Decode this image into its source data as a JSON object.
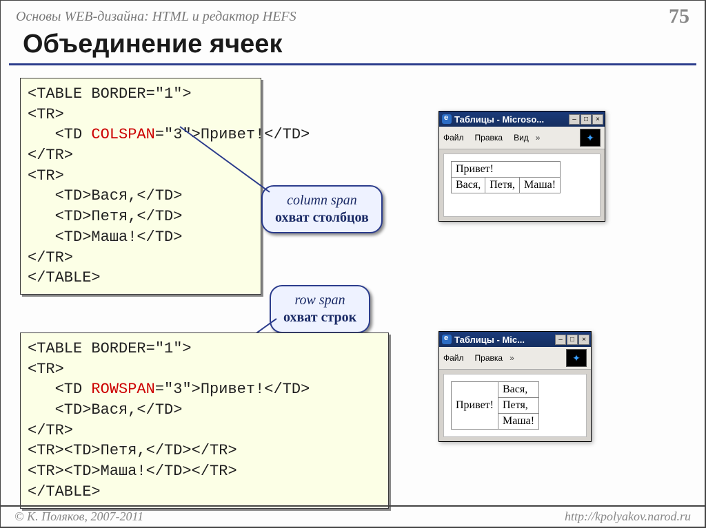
{
  "header": {
    "course": "Основы WEB-дизайна: HTML и редактор HEFS",
    "page": "75"
  },
  "title": "Объединение ячеек",
  "code1": {
    "l1": "<TABLE BORDER=\"1\">",
    "l2": "<TR>",
    "l3a": "   <TD ",
    "l3kw": "COLSPAN",
    "l3b": "=\"3\">Привет!</TD>",
    "l4": "</TR>",
    "l5": "<TR>",
    "l6": "   <TD>Вася,</TD>",
    "l7": "   <TD>Петя,</TD>",
    "l8": "   <TD>Маша!</TD>",
    "l9": "</TR>",
    "l10": "</TABLE>"
  },
  "callout1": {
    "it": "column span",
    "b": "охват столбцов"
  },
  "callout2": {
    "it": "row span",
    "b": "охват строк"
  },
  "code2": {
    "l1": "<TABLE BORDER=\"1\">",
    "l2": "<TR>",
    "l3a": "   <TD ",
    "l3kw": "ROWSPAN",
    "l3b": "=\"3\">Привет!</TD>",
    "l4": "   <TD>Вася,</TD>",
    "l5": "</TR>",
    "l6": "<TR><TD>Петя,</TD></TR>",
    "l7": "<TR><TD>Маша!</TD></TR>",
    "l8": "</TABLE>"
  },
  "browser": {
    "title1": "Таблицы - Microso...",
    "title2": "Таблицы - Mic...",
    "menu": {
      "file": "Файл",
      "edit": "Правка",
      "view": "Вид"
    },
    "table1": {
      "r1c1": "Привет!",
      "r2c1": "Вася,",
      "r2c2": "Петя,",
      "r2c3": "Маша!"
    },
    "table2": {
      "r1c1": "Привет!",
      "r1c2": "Вася,",
      "r2c2": "Петя,",
      "r3c2": "Маша!"
    }
  },
  "footer": {
    "left": "© К. Поляков, 2007-2011",
    "right": "http://kpolyakov.narod.ru"
  }
}
